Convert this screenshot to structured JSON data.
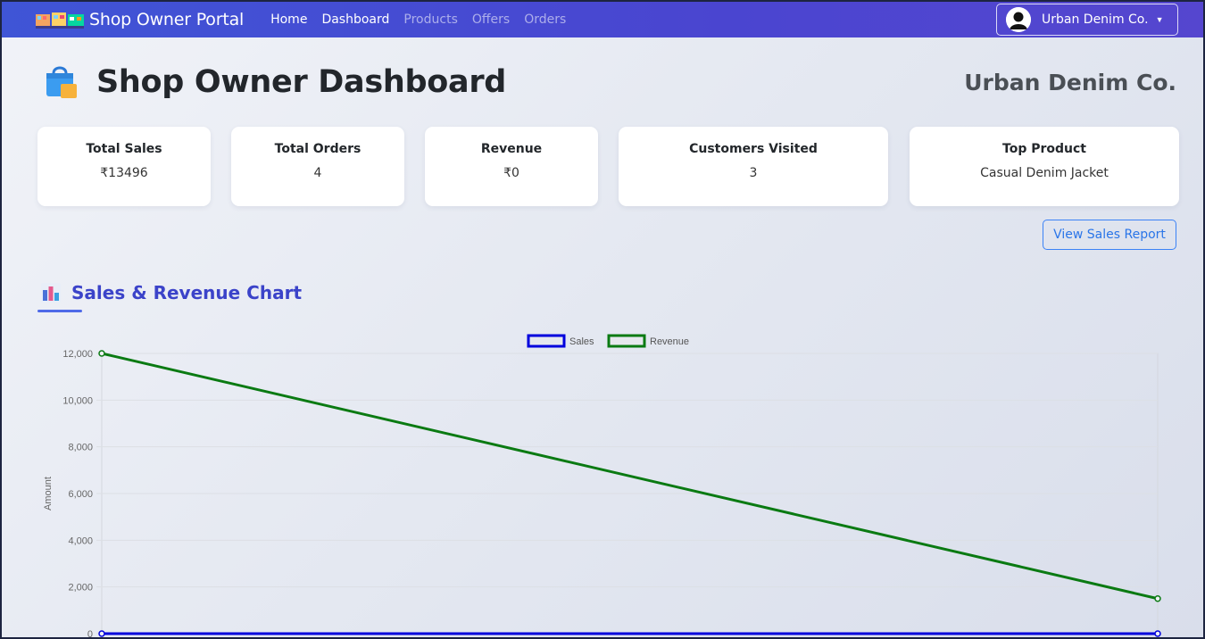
{
  "navbar": {
    "brand": "Shop Owner Portal",
    "links": [
      {
        "label": "Home",
        "active": true
      },
      {
        "label": "Dashboard",
        "active": true
      },
      {
        "label": "Products",
        "active": false
      },
      {
        "label": "Offers",
        "active": false
      },
      {
        "label": "Orders",
        "active": false
      }
    ],
    "user": "Urban Denim Co.",
    "colors": {
      "start": "#3f55d6",
      "end": "#5546cf"
    }
  },
  "header": {
    "title": "Shop Owner Dashboard",
    "shop_name": "Urban Denim Co."
  },
  "stats": [
    {
      "title": "Total Sales",
      "value": "₹13496"
    },
    {
      "title": "Total Orders",
      "value": "4"
    },
    {
      "title": "Revenue",
      "value": "₹0"
    },
    {
      "title": "Customers Visited",
      "value": "3"
    },
    {
      "title": "Top Product",
      "value": "Casual Denim Jacket"
    }
  ],
  "actions": {
    "view_report": "View Sales Report"
  },
  "chart_section": {
    "title": "Sales & Revenue Chart"
  },
  "chart_data": {
    "type": "line",
    "title": "",
    "ylabel": "Amount",
    "xlabel": "",
    "ylim": [
      0,
      12000
    ],
    "yticks": [
      "0",
      "2,000",
      "4,000",
      "6,000",
      "8,000",
      "10,000",
      "12,000"
    ],
    "x": [
      0,
      1
    ],
    "series": [
      {
        "name": "Sales",
        "color": "#0000dd",
        "values": [
          0,
          0
        ]
      },
      {
        "name": "Revenue",
        "color": "#0a7a12",
        "values": [
          12000,
          1500
        ]
      }
    ],
    "legend": "top-center",
    "grid": true
  }
}
